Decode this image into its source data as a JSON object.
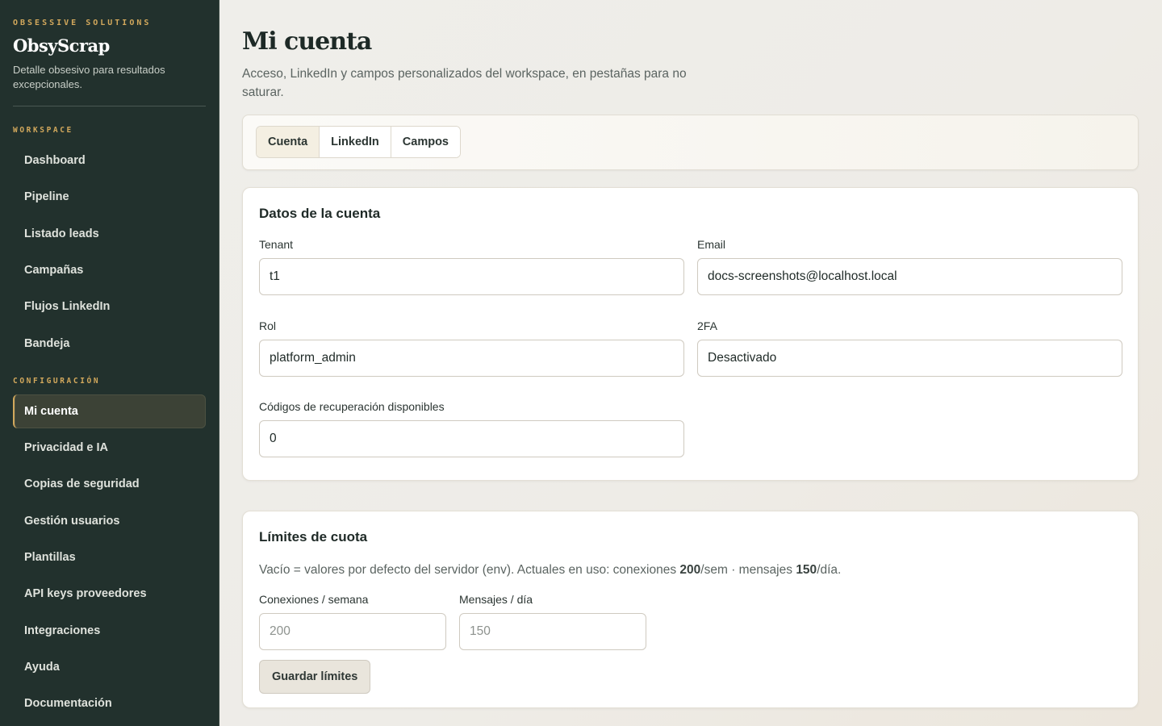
{
  "sidebar": {
    "brand_tag": "OBSESSIVE SOLUTIONS",
    "brand_name": "ObsyScrap",
    "brand_desc": "Detalle obsesivo para resultados excepcionales.",
    "sections": [
      {
        "label": "WORKSPACE",
        "items": [
          "Dashboard",
          "Pipeline",
          "Listado leads",
          "Campañas",
          "Flujos LinkedIn",
          "Bandeja"
        ]
      },
      {
        "label": "CONFIGURACIÓN",
        "items": [
          "Mi cuenta",
          "Privacidad e IA",
          "Copias de seguridad",
          "Gestión usuarios",
          "Plantillas",
          "API keys proveedores",
          "Integraciones",
          "Ayuda",
          "Documentación"
        ]
      }
    ],
    "active_item": "Mi cuenta"
  },
  "main": {
    "title": "Mi cuenta",
    "subtitle": "Acceso, LinkedIn y campos personalizados del workspace, en pestañas para no saturar.",
    "tabs": [
      {
        "label": "Cuenta",
        "active": true
      },
      {
        "label": "LinkedIn",
        "active": false
      },
      {
        "label": "Campos",
        "active": false
      }
    ],
    "account": {
      "title": "Datos de la cuenta",
      "tenant": {
        "label": "Tenant",
        "value": "t1"
      },
      "email": {
        "label": "Email",
        "value": "docs-screenshots@localhost.local"
      },
      "role": {
        "label": "Rol",
        "value": "platform_admin"
      },
      "twofa": {
        "label": "2FA",
        "value": "Desactivado"
      },
      "recovery": {
        "label": "Códigos de recuperación disponibles",
        "value": "0"
      }
    },
    "quota": {
      "title": "Límites de cuota",
      "note_prefix": "Vacío = valores por defecto del servidor (env). Actuales en uso: conexiones ",
      "connections_current": "200",
      "note_mid": "/sem · mensajes ",
      "messages_current": "150",
      "note_suffix": "/día.",
      "connections": {
        "label": "Conexiones / semana",
        "placeholder": "200",
        "value": ""
      },
      "messages": {
        "label": "Mensajes / día",
        "placeholder": "150",
        "value": ""
      },
      "save_label": "Guardar límites"
    }
  },
  "colors": {
    "sidebar_bg": "#22312d",
    "accent": "#d2a85c",
    "page_bg": "#f1efea"
  }
}
